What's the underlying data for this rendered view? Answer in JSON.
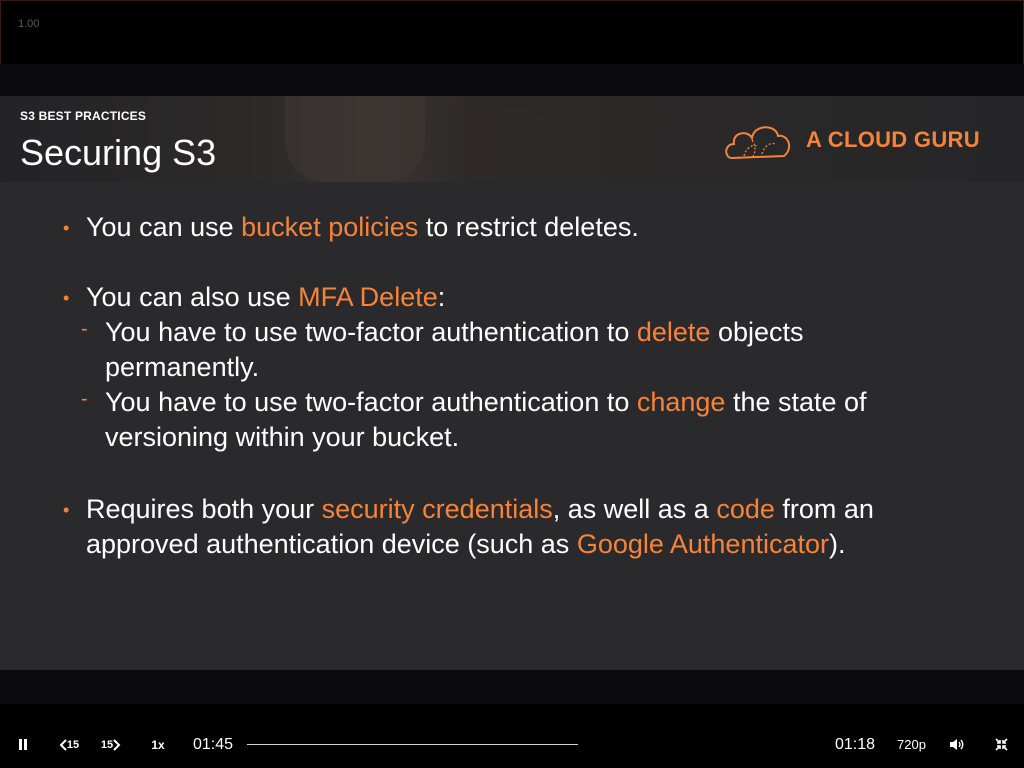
{
  "player": {
    "zoom_label": "1.00",
    "elapsed": "01:45",
    "remaining": "01:18",
    "speed": "1x",
    "rewind_label": "15",
    "forward_label": "15",
    "quality": "720p",
    "icons": [
      "pause-icon",
      "rewind-15-icon",
      "forward-15-icon",
      "volume-icon",
      "exit-fullscreen-icon"
    ]
  },
  "slide": {
    "kicker": "S3 BEST PRACTICES",
    "title": "Securing S3",
    "brand": "A CLOUD GURU",
    "accent_color": "#f5833a",
    "bullets": [
      {
        "pre": "You can use ",
        "hl": "bucket policies",
        "post": " to restrict deletes."
      },
      {
        "pre": "You can also use ",
        "hl": "MFA Delete",
        "post": ":"
      },
      {
        "sub1_pre": "You have to use two-factor authentication to ",
        "sub1_hl": "delete",
        "sub1_post": " objects",
        "sub1_line2": "permanently."
      },
      {
        "sub2_pre": "You have to use two-factor authentication to ",
        "sub2_hl": "change",
        "sub2_post": " the state of",
        "sub2_line2": "versioning within your bucket."
      },
      {
        "p1": "Requires both your ",
        "h1": "security credentials",
        "p2": ", as well as a ",
        "h2": "code",
        "p3": " from an",
        "p4": "approved authentication device (such as ",
        "h3": "Google Authenticator",
        "p5": ")."
      }
    ]
  }
}
